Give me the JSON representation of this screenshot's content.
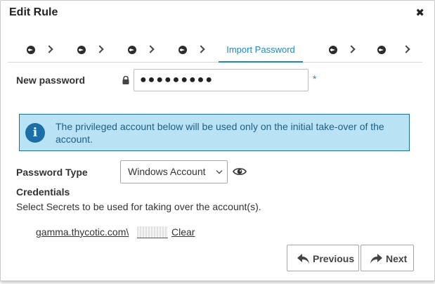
{
  "dialog": {
    "title": "Edit Rule",
    "close_glyph": "✖"
  },
  "wizard": {
    "active_step_label": "Import Password"
  },
  "new_password": {
    "label": "New password",
    "value": "●●●●●●●●●",
    "required_mark": "*"
  },
  "info": {
    "text": "The privileged account below will be used only on the initial take-over of the account."
  },
  "password_type": {
    "label": "Password Type",
    "selected": "Windows Account"
  },
  "credentials": {
    "heading": "Credentials",
    "help": "Select Secrets to be used for taking over the account(s).",
    "secret_link": "gamma.thycotic.com\\",
    "clear_label": "Clear"
  },
  "buttons": {
    "previous": "Previous",
    "next": "Next"
  },
  "colors": {
    "accent": "#1e88c7",
    "info_bg": "#b9e3f5",
    "info_icon": "#1b6fa8"
  }
}
